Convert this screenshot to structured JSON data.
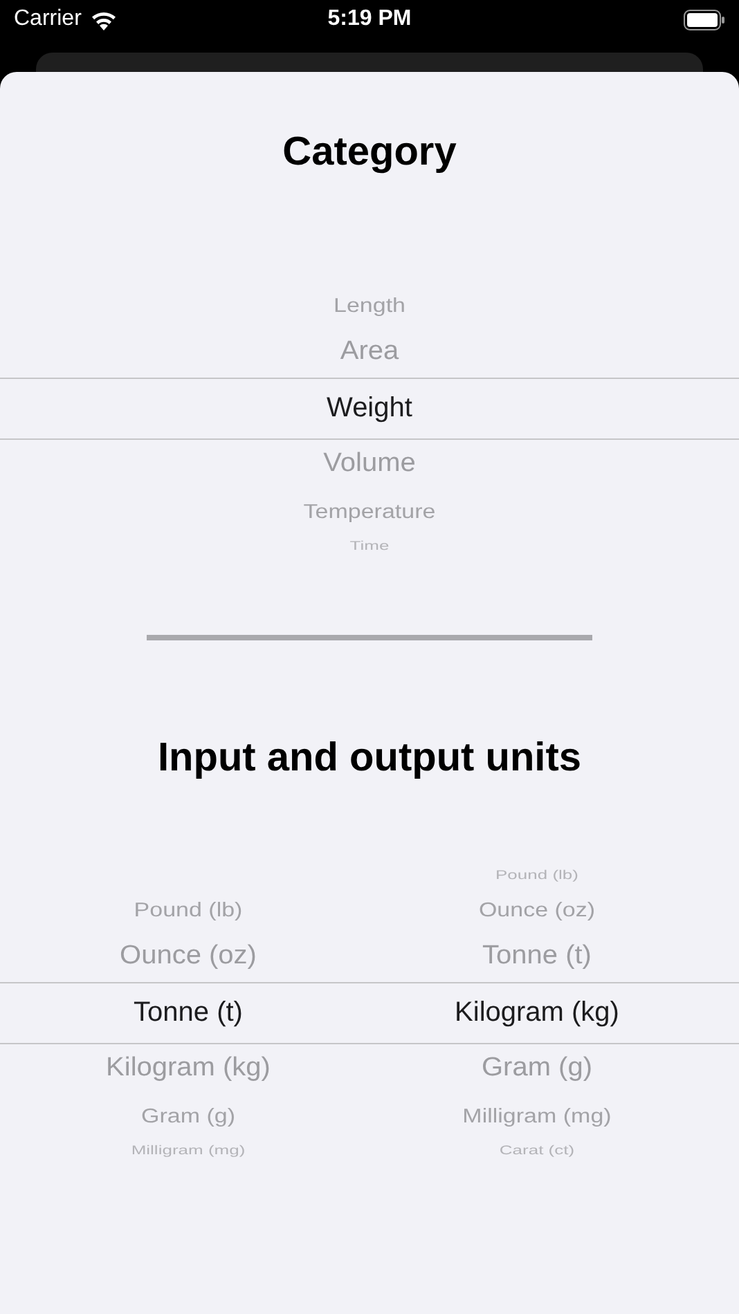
{
  "status_bar": {
    "carrier": "Carrier",
    "time": "5:19 PM"
  },
  "category": {
    "title": "Category",
    "items": [
      {
        "label": "Length",
        "selected": false
      },
      {
        "label": "Area",
        "selected": false
      },
      {
        "label": "Weight",
        "selected": true
      },
      {
        "label": "Volume",
        "selected": false
      },
      {
        "label": "Temperature",
        "selected": false
      },
      {
        "label": "Time",
        "selected": false
      }
    ]
  },
  "units": {
    "title": "Input and output units",
    "input": [
      {
        "label": "Pound (lb)",
        "selected": false
      },
      {
        "label": "Ounce (oz)",
        "selected": false
      },
      {
        "label": "Tonne (t)",
        "selected": true
      },
      {
        "label": "Kilogram (kg)",
        "selected": false
      },
      {
        "label": "Gram (g)",
        "selected": false
      },
      {
        "label": "Milligram (mg)",
        "selected": false
      }
    ],
    "output": [
      {
        "label": "Pound (lb)",
        "selected": false
      },
      {
        "label": "Ounce (oz)",
        "selected": false
      },
      {
        "label": "Tonne (t)",
        "selected": false
      },
      {
        "label": "Kilogram (kg)",
        "selected": true
      },
      {
        "label": "Gram (g)",
        "selected": false
      },
      {
        "label": "Milligram (mg)",
        "selected": false
      },
      {
        "label": "Carat (ct)",
        "selected": false
      }
    ]
  }
}
